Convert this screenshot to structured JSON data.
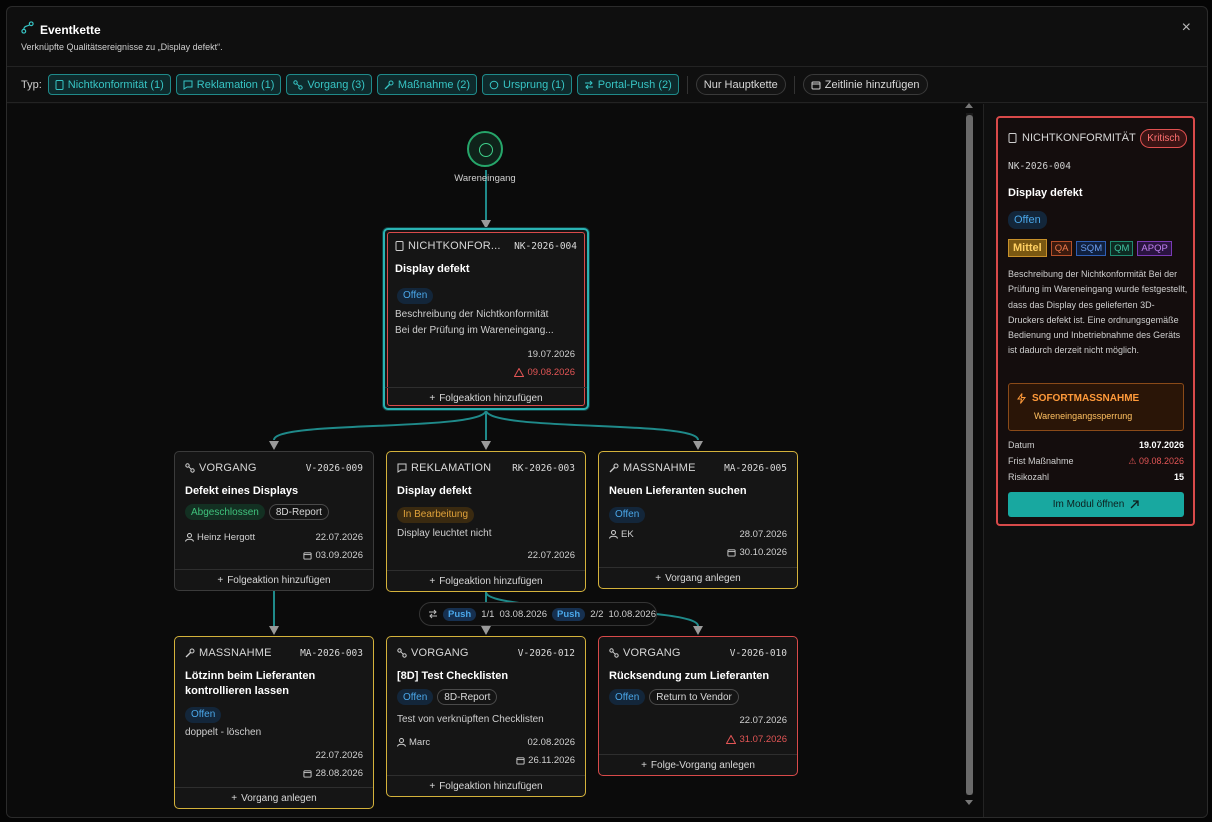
{
  "dialog": {
    "title": "Eventkette",
    "subtitle": "Verknüpfte Qualitätsereignisse zu „Display defekt“.",
    "close_icon": "×"
  },
  "filters": {
    "label": "Typ:",
    "chips": [
      {
        "label": "Nichtkonformität (1)",
        "icon": "document-icon"
      },
      {
        "label": "Reklamation (1)",
        "icon": "message-icon"
      },
      {
        "label": "Vorgang (3)",
        "icon": "link-icon"
      },
      {
        "label": "Maßnahme (2)",
        "icon": "wrench-icon"
      },
      {
        "label": "Ursprung (1)",
        "icon": "circle-icon"
      },
      {
        "label": "Portal-Push (2)",
        "icon": "arrows-icon"
      }
    ],
    "main_chain": "Nur Hauptkette",
    "add_timeline": "Zeitlinie hinzufügen"
  },
  "graph": {
    "start_label": "Wareneingang",
    "nodes": {
      "nk": {
        "type": "NICHTKONFOR...",
        "code": "NK-2026-004",
        "title": "Display defekt",
        "status": "Offen",
        "desc1": "Beschreibung der Nichtkonformität",
        "desc2": "Bei der Prüfung im Wareneingang...",
        "date": "19.07.2026",
        "due": "09.08.2026",
        "footer": "Folgeaktion hinzufügen"
      },
      "v009": {
        "type": "VORGANG",
        "code": "V-2026-009",
        "title": "Defekt eines Displays",
        "status": "Abgeschlossen",
        "tag": "8D-Report",
        "person": "Heinz Hergott",
        "date": "22.07.2026",
        "due": "03.09.2026",
        "footer": "Folgeaktion hinzufügen"
      },
      "rk003": {
        "type": "REKLAMATION",
        "code": "RK-2026-003",
        "title": "Display defekt",
        "status": "In Bearbeitung",
        "desc": "Display leuchtet nicht",
        "date": "22.07.2026",
        "footer": "Folgeaktion hinzufügen"
      },
      "ma005": {
        "type": "MASSNAHME",
        "code": "MA-2026-005",
        "title": "Neuen Lieferanten suchen",
        "status": "Offen",
        "person": "EK",
        "date": "28.07.2026",
        "due": "30.10.2026",
        "footer": "Vorgang anlegen"
      },
      "ma003": {
        "type": "MASSNAHME",
        "code": "MA-2026-003",
        "title1": "Lötzinn beim Lieferanten",
        "title2": "kontrollieren lassen",
        "status": "Offen",
        "desc": "doppelt - löschen",
        "date": "22.07.2026",
        "due": "28.08.2026",
        "footer": "Vorgang anlegen"
      },
      "v012": {
        "type": "VORGANG",
        "code": "V-2026-012",
        "title": "[8D] Test Checklisten",
        "status": "Offen",
        "tag": "8D-Report",
        "desc": "Test von verknüpften Checklisten",
        "person": "Marc",
        "date": "02.08.2026",
        "due": "26.11.2026",
        "footer": "Folgeaktion hinzufügen"
      },
      "v010": {
        "type": "VORGANG",
        "code": "V-2026-010",
        "title": "Rücksendung zum Lieferanten",
        "status": "Offen",
        "tag": "Return to Vendor",
        "date": "22.07.2026",
        "due": "31.07.2026",
        "footer": "Folge-Vorgang anlegen"
      }
    },
    "push": {
      "tag": "Push",
      "p1_count": "1/1",
      "p1_date": "03.08.2026",
      "p2_count": "2/2",
      "p2_date": "10.08.2026"
    }
  },
  "side": {
    "type": "NICHTKONFORMITÄT",
    "severity": "Kritisch",
    "code": "NK-2026-004",
    "title": "Display defekt",
    "status": "Offen",
    "priority": "Mittel",
    "tags": [
      "QA",
      "SQM",
      "QM",
      "APQP"
    ],
    "description": "Beschreibung der Nichtkonformität Bei der Prüfung im Wareneingang wurde festgestellt, dass das Display des gelieferten 3D-Druckers defekt ist. Eine ordnungsgemäße Bedienung und Inbetriebnahme des Geräts ist dadurch derzeit nicht möglich.",
    "sofort_title": "SOFORTMASSNAHME",
    "sofort_value": "Wareneingangssperrung",
    "date_label": "Datum",
    "date_value": "19.07.2026",
    "due_label": "Frist Maßnahme",
    "due_value": "09.08.2026",
    "risk_label": "Risikozahl",
    "risk_value": "15",
    "open_button": "Im Modul öffnen"
  },
  "colors": {
    "teal": "#2ab3b3",
    "yellow": "#d4b23b",
    "red": "#d84a4a",
    "blue": "#4aa6e8",
    "green": "#3fc27c"
  }
}
